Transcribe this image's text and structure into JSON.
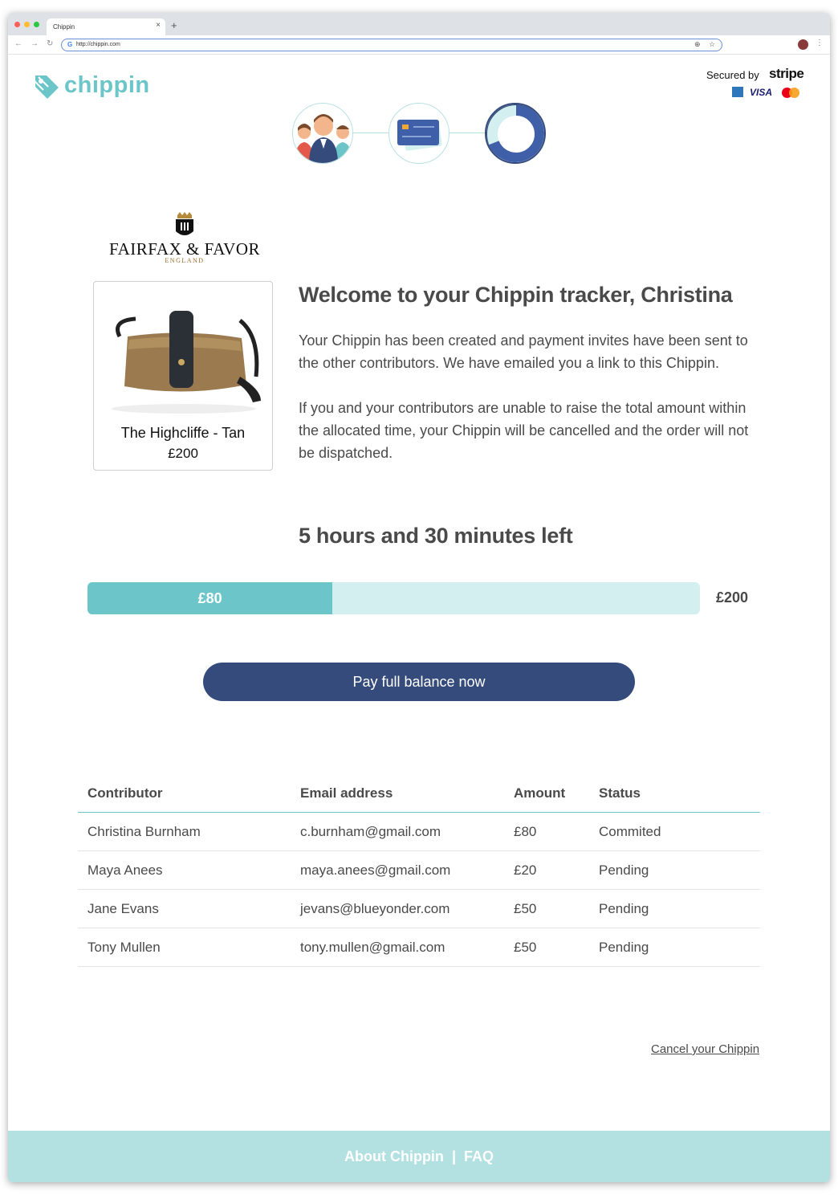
{
  "browser": {
    "tab_title": "Chippin",
    "tab_close": "×",
    "new_tab": "+",
    "url": "http://chippin.com"
  },
  "header": {
    "logo_text": "chippin",
    "secured_by": "Secured by",
    "stripe": "stripe",
    "visa": "VISA"
  },
  "brand": {
    "name": "FAIRFAX & FAVOR",
    "sub": "ENGLAND"
  },
  "product": {
    "name": "The Highcliffe - Tan",
    "price": "£200"
  },
  "welcome": {
    "title": "Welcome to your Chippin tracker, Christina",
    "para1": "Your Chippin has been created and payment invites have been sent to the other contributors. We have emailed you a link to this Chippin.",
    "para2": "If you and your contributors are unable to raise the total amount within the allocated time, your Chippin will be cancelled and the order will not be dispatched."
  },
  "tracker": {
    "time_left": "5 hours and 30 minutes left",
    "raised_label": "£80",
    "raised": 80,
    "total_label": "£200",
    "total": 200,
    "pay_button": "Pay full balance now"
  },
  "table": {
    "headers": [
      "Contributor",
      "Email address",
      "Amount",
      "Status"
    ],
    "rows": [
      {
        "name": "Christina Burnham",
        "email": "c.burnham@gmail.com",
        "amount": "£80",
        "status": "Commited"
      },
      {
        "name": "Maya Anees",
        "email": "maya.anees@gmail.com",
        "amount": "£20",
        "status": "Pending"
      },
      {
        "name": "Jane Evans",
        "email": "jevans@blueyonder.com",
        "amount": "£50",
        "status": "Pending"
      },
      {
        "name": "Tony Mullen",
        "email": "tony.mullen@gmail.com",
        "amount": "£50",
        "status": "Pending"
      }
    ]
  },
  "cancel_link": "Cancel your Chippin",
  "footer": {
    "about": "About Chippin",
    "separator": "|",
    "faq": "FAQ"
  },
  "colors": {
    "accent": "#6cc5c8",
    "accent_light": "#d3efef",
    "button": "#344b7c",
    "footer": "#b3e0e1"
  }
}
